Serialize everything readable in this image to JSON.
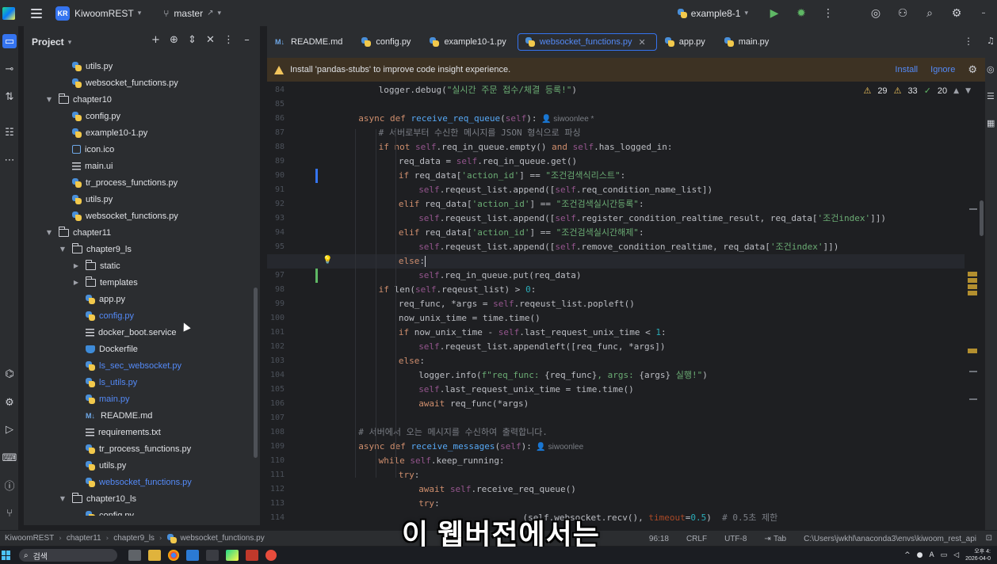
{
  "titlebar": {
    "project_initials": "KR",
    "project_name": "KiwoomREST",
    "branch": "master",
    "branch_suffix": "↗",
    "run_config": "example8-1"
  },
  "project_panel": {
    "title": "Project",
    "tree": [
      {
        "label": "utils.py",
        "type": "py",
        "depth": 3,
        "modified": false
      },
      {
        "label": "websocket_functions.py",
        "type": "py",
        "depth": 3,
        "modified": false
      },
      {
        "label": "chapter10",
        "type": "folder",
        "depth": 2,
        "expanded": true
      },
      {
        "label": "config.py",
        "type": "py",
        "depth": 3,
        "modified": false
      },
      {
        "label": "example10-1.py",
        "type": "py",
        "depth": 3,
        "modified": false
      },
      {
        "label": "icon.ico",
        "type": "ico",
        "depth": 3,
        "modified": false
      },
      {
        "label": "main.ui",
        "type": "txt",
        "depth": 3,
        "modified": false
      },
      {
        "label": "tr_process_functions.py",
        "type": "py",
        "depth": 3,
        "modified": false
      },
      {
        "label": "utils.py",
        "type": "py",
        "depth": 3,
        "modified": false
      },
      {
        "label": "websocket_functions.py",
        "type": "py",
        "depth": 3,
        "modified": false
      },
      {
        "label": "chapter11",
        "type": "folder",
        "depth": 2,
        "expanded": true
      },
      {
        "label": "chapter9_ls",
        "type": "folder",
        "depth": 3,
        "expanded": true
      },
      {
        "label": "static",
        "type": "folder",
        "depth": 4,
        "expanded": false
      },
      {
        "label": "templates",
        "type": "folder",
        "depth": 4,
        "expanded": false
      },
      {
        "label": "app.py",
        "type": "py",
        "depth": 4,
        "modified": false
      },
      {
        "label": "config.py",
        "type": "py",
        "depth": 4,
        "modified": true
      },
      {
        "label": "docker_boot.service",
        "type": "txt",
        "depth": 4,
        "modified": false
      },
      {
        "label": "Dockerfile",
        "type": "docker",
        "depth": 4,
        "modified": false
      },
      {
        "label": "ls_sec_websocket.py",
        "type": "py",
        "depth": 4,
        "modified": true
      },
      {
        "label": "ls_utils.py",
        "type": "py",
        "depth": 4,
        "modified": true
      },
      {
        "label": "main.py",
        "type": "py",
        "depth": 4,
        "modified": true
      },
      {
        "label": "README.md",
        "type": "md",
        "depth": 4,
        "modified": false
      },
      {
        "label": "requirements.txt",
        "type": "txt",
        "depth": 4,
        "modified": false
      },
      {
        "label": "tr_process_functions.py",
        "type": "py",
        "depth": 4,
        "modified": false
      },
      {
        "label": "utils.py",
        "type": "py",
        "depth": 4,
        "modified": false
      },
      {
        "label": "websocket_functions.py",
        "type": "py",
        "depth": 4,
        "modified": true
      },
      {
        "label": "chapter10_ls",
        "type": "folder",
        "depth": 3,
        "expanded": true
      },
      {
        "label": "config.py",
        "type": "py",
        "depth": 4,
        "modified": false
      }
    ]
  },
  "tabs": [
    {
      "label": "README.md",
      "type": "md",
      "active": false
    },
    {
      "label": "config.py",
      "type": "py",
      "active": false
    },
    {
      "label": "example10-1.py",
      "type": "py",
      "active": false
    },
    {
      "label": "websocket_functions.py",
      "type": "py",
      "active": true
    },
    {
      "label": "app.py",
      "type": "py",
      "active": false
    },
    {
      "label": "main.py",
      "type": "py",
      "active": false
    }
  ],
  "banner": {
    "message": "Install 'pandas-stubs' to improve code insight experience.",
    "install": "Install",
    "ignore": "Ignore"
  },
  "inspections": {
    "warnings_a": "29",
    "warnings_b": "33",
    "ok": "20"
  },
  "editor": {
    "current_line": 96,
    "lines": [
      {
        "n": 84,
        "i": 2,
        "t": [
          [
            "",
            "logger.debug("
          ],
          [
            "str",
            "\"실시간 주문 접수/체결 등록!\""
          ],
          [
            "",
            ")"
          ]
        ]
      },
      {
        "n": 85,
        "i": 0,
        "t": []
      },
      {
        "n": 86,
        "i": 1,
        "t": [
          [
            "kw",
            "async def "
          ],
          [
            "fn",
            "receive_req_queue"
          ],
          [
            "",
            "("
          ],
          [
            "self",
            "self"
          ],
          [
            "",
            "):"
          ],
          [
            "hint",
            "  👤 siwoonlee *"
          ]
        ]
      },
      {
        "n": 87,
        "i": 2,
        "t": [
          [
            "cmt",
            "# 서버로부터 수신한 메시지를 JSON 형식으로 파싱"
          ]
        ]
      },
      {
        "n": 88,
        "i": 2,
        "t": [
          [
            "kw",
            "if not "
          ],
          [
            "self",
            "self"
          ],
          [
            "",
            ".req_in_queue.empty() "
          ],
          [
            "kw",
            "and "
          ],
          [
            "self",
            "self"
          ],
          [
            "",
            ".has_logged_in:"
          ]
        ]
      },
      {
        "n": 89,
        "i": 3,
        "t": [
          [
            "",
            "req_data = "
          ],
          [
            "self",
            "self"
          ],
          [
            "",
            ".req_in_queue.get()"
          ]
        ]
      },
      {
        "n": 90,
        "i": 3,
        "t": [
          [
            "kw",
            "if "
          ],
          [
            "",
            "req_data["
          ],
          [
            "str",
            "'action_id'"
          ],
          [
            "",
            "] == "
          ],
          [
            "str",
            "\"조건검색식리스트\""
          ],
          [
            "",
            ":"
          ]
        ]
      },
      {
        "n": 91,
        "i": 4,
        "t": [
          [
            "self",
            "self"
          ],
          [
            "",
            ".reqeust_list.append(["
          ],
          [
            "self",
            "self"
          ],
          [
            "",
            ".req_condition_name_list])"
          ]
        ]
      },
      {
        "n": 92,
        "i": 3,
        "t": [
          [
            "kw",
            "elif "
          ],
          [
            "",
            "req_data["
          ],
          [
            "str",
            "'action_id'"
          ],
          [
            "",
            "] == "
          ],
          [
            "str",
            "\"조건검색실시간등록\""
          ],
          [
            "",
            ":"
          ]
        ]
      },
      {
        "n": 93,
        "i": 4,
        "t": [
          [
            "self",
            "self"
          ],
          [
            "",
            ".reqeust_list.append(["
          ],
          [
            "self",
            "self"
          ],
          [
            "",
            ".register_condition_realtime_result, req_data["
          ],
          [
            "str",
            "'조건index'"
          ],
          [
            "",
            "]])"
          ]
        ]
      },
      {
        "n": 94,
        "i": 3,
        "t": [
          [
            "kw",
            "elif "
          ],
          [
            "",
            "req_data["
          ],
          [
            "str",
            "'action_id'"
          ],
          [
            "",
            "] == "
          ],
          [
            "str",
            "\"조건검색실시간해제\""
          ],
          [
            "",
            ":"
          ]
        ]
      },
      {
        "n": 95,
        "i": 4,
        "t": [
          [
            "self",
            "self"
          ],
          [
            "",
            ".reqeust_list.append(["
          ],
          [
            "self",
            "self"
          ],
          [
            "",
            ".remove_condition_realtime, req_data["
          ],
          [
            "str",
            "'조건index'"
          ],
          [
            "",
            "]])"
          ]
        ]
      },
      {
        "n": 96,
        "i": 3,
        "t": [
          [
            "kw",
            "else"
          ],
          [
            "",
            ":"
          ],
          [
            "caret",
            ""
          ]
        ]
      },
      {
        "n": 97,
        "i": 4,
        "t": [
          [
            "self",
            "self"
          ],
          [
            "",
            ".req_in_queue.put(req_data)"
          ]
        ]
      },
      {
        "n": 98,
        "i": 2,
        "t": [
          [
            "kw",
            "if "
          ],
          [
            "",
            "len("
          ],
          [
            "self",
            "self"
          ],
          [
            "",
            ".reqeust_list) > "
          ],
          [
            "num",
            "0"
          ],
          [
            "",
            ":"
          ]
        ]
      },
      {
        "n": 99,
        "i": 3,
        "t": [
          [
            "",
            "req_func, *args = "
          ],
          [
            "self",
            "self"
          ],
          [
            "",
            ".reqeust_list.popleft()"
          ]
        ]
      },
      {
        "n": 100,
        "i": 3,
        "t": [
          [
            "",
            "now_unix_time = time.time()"
          ]
        ]
      },
      {
        "n": 101,
        "i": 3,
        "t": [
          [
            "kw",
            "if "
          ],
          [
            "",
            "now_unix_time - "
          ],
          [
            "self",
            "self"
          ],
          [
            "",
            ".last_request_unix_time < "
          ],
          [
            "num",
            "1"
          ],
          [
            "",
            ":"
          ]
        ]
      },
      {
        "n": 102,
        "i": 4,
        "t": [
          [
            "self",
            "self"
          ],
          [
            "",
            ".reqeust_list.appendleft([req_func, *args])"
          ]
        ]
      },
      {
        "n": 103,
        "i": 3,
        "t": [
          [
            "kw",
            "else"
          ],
          [
            "",
            ":"
          ]
        ]
      },
      {
        "n": 104,
        "i": 4,
        "t": [
          [
            "",
            "logger.info("
          ],
          [
            "str",
            "f\"req_func: "
          ],
          [
            "",
            "{req_func}"
          ],
          [
            "str",
            ", args: "
          ],
          [
            "",
            "{args}"
          ],
          [
            "str",
            " 실행!\""
          ],
          [
            "",
            ")"
          ]
        ]
      },
      {
        "n": 105,
        "i": 4,
        "t": [
          [
            "self",
            "self"
          ],
          [
            "",
            ".last_request_unix_time = time.time()"
          ]
        ]
      },
      {
        "n": 106,
        "i": 4,
        "t": [
          [
            "kw",
            "await "
          ],
          [
            "",
            "req_func(*args)"
          ]
        ]
      },
      {
        "n": 107,
        "i": 0,
        "t": []
      },
      {
        "n": 108,
        "i": 1,
        "t": [
          [
            "cmt",
            "# 서버에서 오는 메시지를 수신하여 출력합니다."
          ]
        ]
      },
      {
        "n": 109,
        "i": 1,
        "t": [
          [
            "kw",
            "async def "
          ],
          [
            "fn",
            "receive_messages"
          ],
          [
            "",
            "("
          ],
          [
            "self",
            "self"
          ],
          [
            "",
            "):"
          ],
          [
            "hint",
            "  👤 siwoonlee"
          ]
        ]
      },
      {
        "n": 110,
        "i": 2,
        "t": [
          [
            "kw",
            "while "
          ],
          [
            "self",
            "self"
          ],
          [
            "",
            ".keep_running:"
          ]
        ]
      },
      {
        "n": 111,
        "i": 3,
        "t": [
          [
            "kw",
            "try"
          ],
          [
            "",
            ":"
          ]
        ]
      },
      {
        "n": 112,
        "i": 4,
        "t": [
          [
            "kw",
            "await "
          ],
          [
            "self",
            "self"
          ],
          [
            "",
            ".receive_req_queue()"
          ]
        ]
      },
      {
        "n": 113,
        "i": 4,
        "t": [
          [
            "kw",
            "try"
          ],
          [
            "",
            ":"
          ]
        ]
      },
      {
        "n": 114,
        "i": 5,
        "t": [
          [
            "",
            "                (self.websocket.recv(), "
          ],
          [
            "kwarg",
            "timeout"
          ],
          [
            "",
            "="
          ],
          [
            "num",
            "0.5"
          ],
          [
            "",
            ")  "
          ],
          [
            "cmt",
            "# 0.5초 제한"
          ]
        ]
      }
    ]
  },
  "statusbar": {
    "breadcrumb": [
      "KiwoomREST",
      "chapter11",
      "chapter9_ls",
      "websocket_functions.py"
    ],
    "position": "96:18",
    "line_ending": "CRLF",
    "encoding": "UTF-8",
    "indent": "Tab",
    "interpreter": "C:\\Users\\jwkhl\\anaconda3\\envs\\kiwoom_rest_api"
  },
  "subtitle": "이 웹버전에서는",
  "taskbar": {
    "search_placeholder": "검색",
    "clock_time": "오후 4:",
    "clock_date": "2026-04-0"
  }
}
